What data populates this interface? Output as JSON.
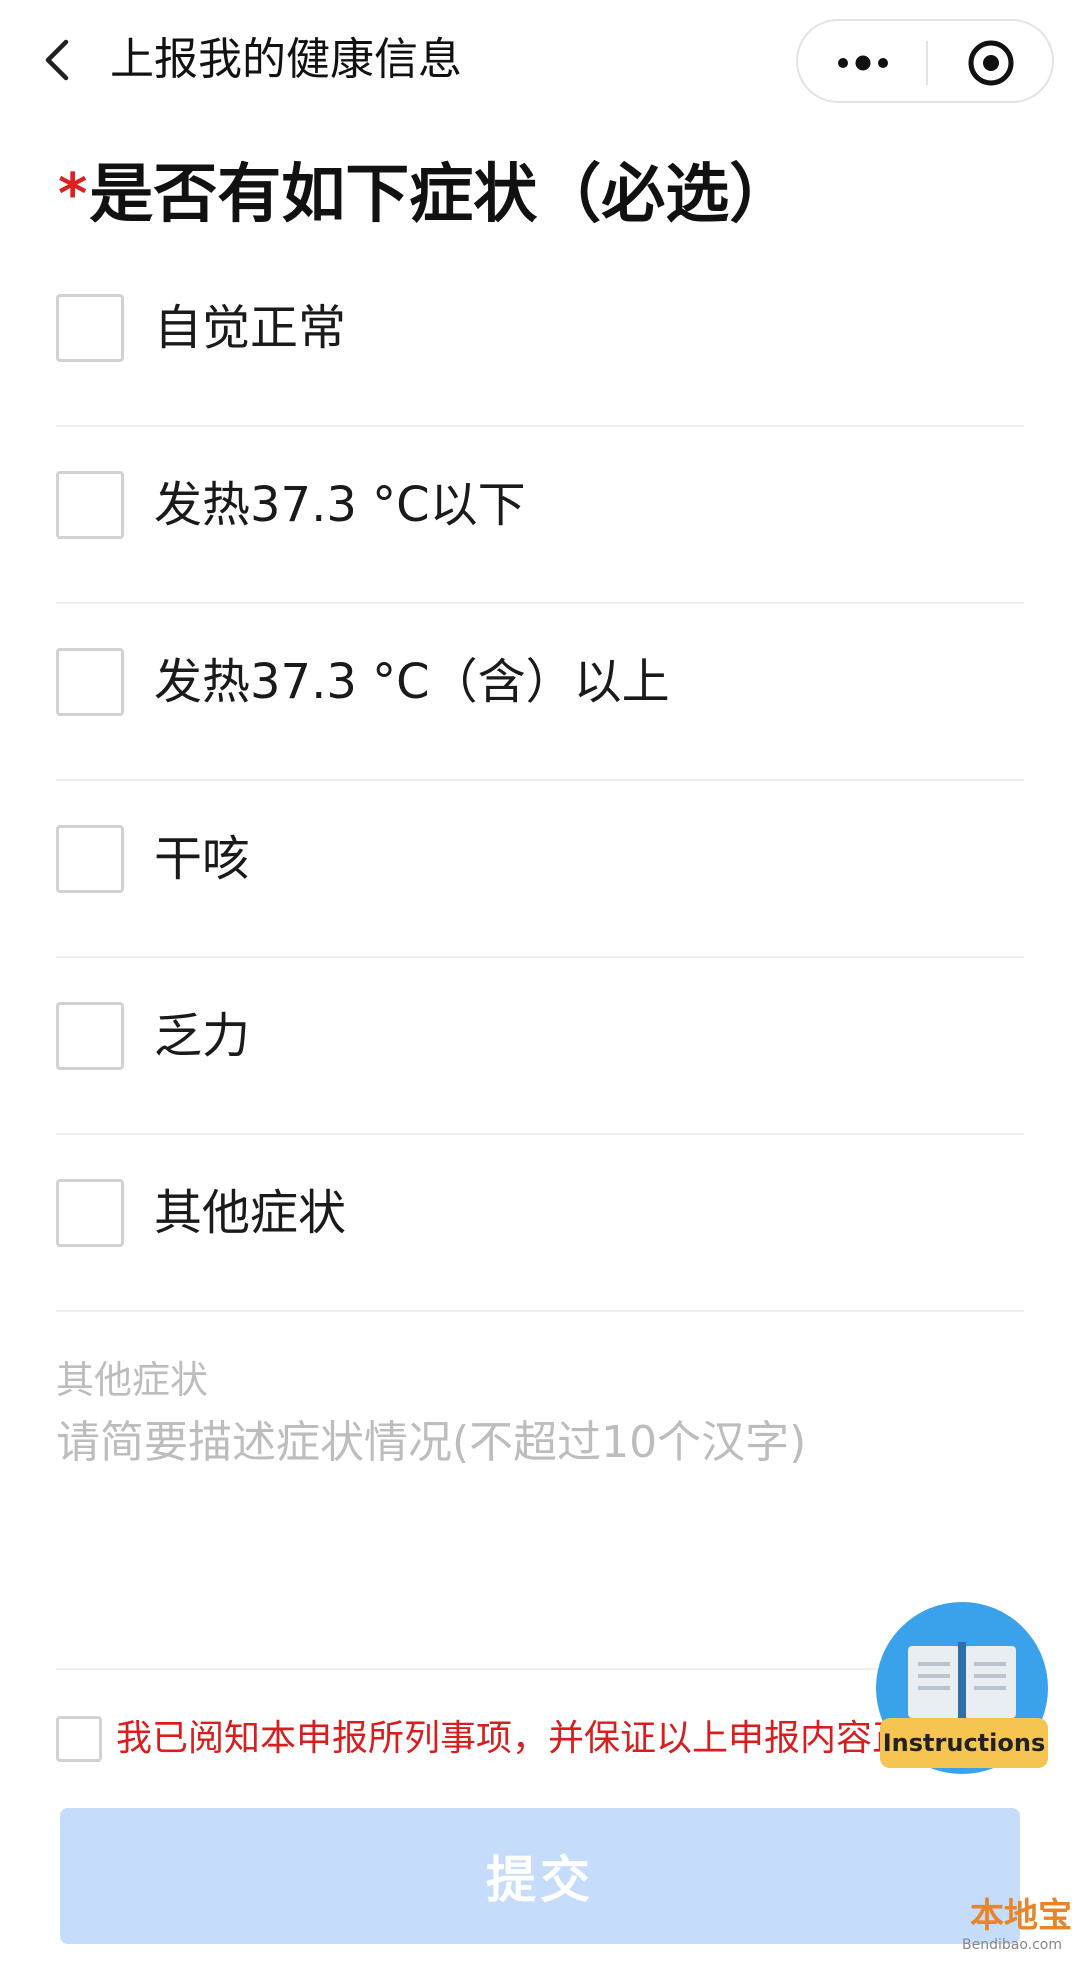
{
  "nav": {
    "title": "上报我的健康信息",
    "back_icon": "chevron-left-icon",
    "more_icon": "more-dots-icon",
    "close_icon": "target-close-icon"
  },
  "form": {
    "required_mark": "*",
    "question": "是否有如下症状（必选）",
    "options": [
      {
        "label": "自觉正常",
        "checked": false
      },
      {
        "label": "发热37.3 °C以下",
        "checked": false
      },
      {
        "label": "发热37.3 °C（含）以上",
        "checked": false
      },
      {
        "label": "干咳",
        "checked": false
      },
      {
        "label": "乏力",
        "checked": false
      },
      {
        "label": "其他症状",
        "checked": false
      }
    ],
    "other_label": "其他症状",
    "other_placeholder": "请简要描述症状情况(不超过10个汉字)",
    "other_value": ""
  },
  "agreement": {
    "text": "我已阅知本申报所列事项，并保证以上申报内容正",
    "checked": false
  },
  "instructions": {
    "label": "Instructions",
    "icon": "book-icon"
  },
  "submit": {
    "label": "提交"
  },
  "watermark": {
    "main": "本地宝",
    "sub": "Bendibao.com"
  },
  "colors": {
    "required": "#e02020",
    "agreement_text": "#d81e1e",
    "submit_disabled_bg": "#c5dcfa",
    "instructions_circle": "#3aa2ea",
    "instructions_label_bg": "#f5c451",
    "placeholder": "#bdbdbd"
  }
}
